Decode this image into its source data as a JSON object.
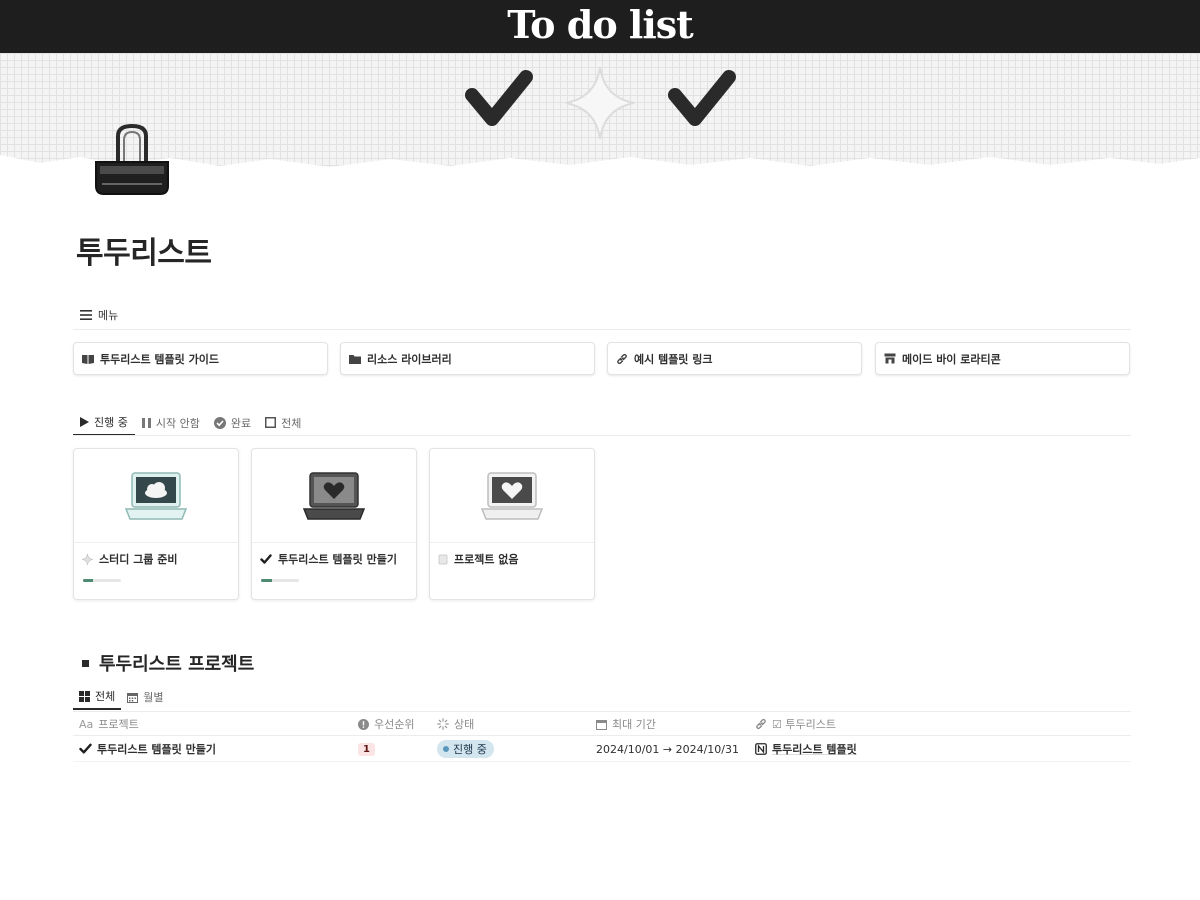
{
  "cover": {
    "title": "To do list"
  },
  "page": {
    "title": "투두리스트"
  },
  "menu": {
    "label": "메뉴",
    "items": [
      {
        "label": "투두리스트 템플릿 가이드",
        "icon": "book-icon"
      },
      {
        "label": "리소스 라이브러리",
        "icon": "folder-icon"
      },
      {
        "label": "예시 템플릿 링크",
        "icon": "link-icon"
      },
      {
        "label": "메이드 바이 로라티콘",
        "icon": "store-icon"
      }
    ]
  },
  "status_tabs": [
    {
      "label": "진행 중",
      "icon": "play-icon",
      "active": true
    },
    {
      "label": "시작 안함",
      "icon": "pause-icon",
      "active": false
    },
    {
      "label": "완료",
      "icon": "check-circle-icon",
      "active": false
    },
    {
      "label": "전체",
      "icon": "square-icon",
      "active": false
    }
  ],
  "gallery": [
    {
      "title": "스터디 그룹 준비",
      "icon": "sparkle-icon",
      "image": "laptop-cloud",
      "progress": 0.25
    },
    {
      "title": "투두리스트 템플릿 만들기",
      "icon": "checkmark-icon",
      "image": "laptop-heart-dark",
      "progress": 0.3
    },
    {
      "title": "프로젝트 없음",
      "icon": "page-icon",
      "image": "laptop-heart-light",
      "progress": null
    }
  ],
  "projects": {
    "title": "투두리스트 프로젝트",
    "views": [
      {
        "label": "전체",
        "icon": "grid-icon",
        "active": true
      },
      {
        "label": "월별",
        "icon": "calendar-icon",
        "active": false
      }
    ],
    "columns": [
      {
        "label": "프로젝트",
        "icon": "Aa"
      },
      {
        "label": "우선순위",
        "icon": "info-icon"
      },
      {
        "label": "상태",
        "icon": "status-icon"
      },
      {
        "label": "최대 기간",
        "icon": "calendar-icon"
      },
      {
        "label": "☑ 투두리스트",
        "icon": "link-icon"
      }
    ],
    "rows": [
      {
        "project": "투두리스트 템플릿 만들기",
        "priority": "1",
        "status": "진행 중",
        "period": "2024/10/01 → 2024/10/31",
        "todo": "투두리스트 템플릿"
      }
    ]
  },
  "colors": {
    "accent": "#4f8a72",
    "status_bg": "#d3e5ef",
    "priority_bg": "#fbe4e4",
    "cover_bar": "#1e1e1e"
  }
}
